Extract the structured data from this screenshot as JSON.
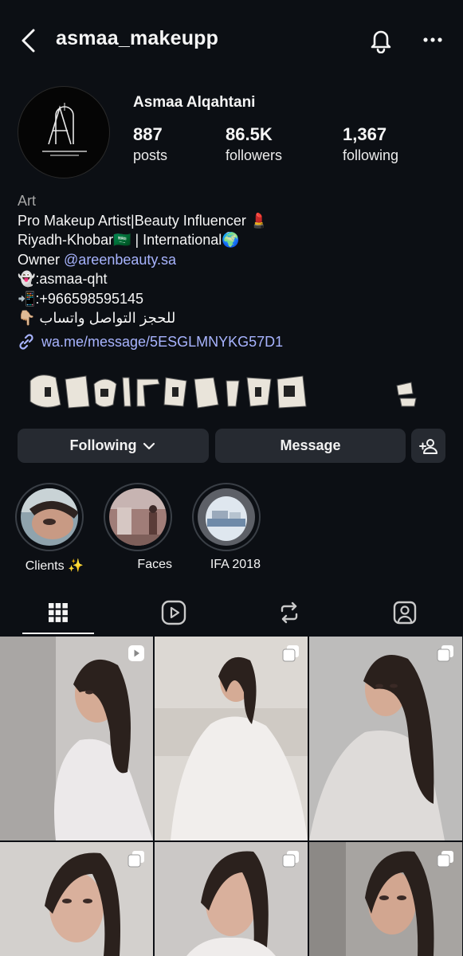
{
  "header": {
    "username": "asmaa_makeupp",
    "back_icon": "chevron-left-icon",
    "bell_icon": "bell-icon",
    "more_icon": "more-horizontal-icon"
  },
  "profile": {
    "full_name": "Asmaa Alqahtani",
    "avatar_logo_text": "Asmaa AlQahtani Makeup Artist",
    "stats": [
      {
        "value": "887",
        "label": "posts"
      },
      {
        "value": "86.5K",
        "label": "followers"
      },
      {
        "value": "1,367",
        "label": "following"
      }
    ]
  },
  "bio": {
    "category": "Art",
    "line1": "Pro Makeup Artist|Beauty Influencer 💄",
    "line2": "Riyadh-Khobar🇸🇦 | International🌍",
    "line3_prefix": "Owner ",
    "line3_mention": "@areenbeauty.sa",
    "line4": "👻:asmaa-qht",
    "line5": "📲:+966598595145",
    "line6": "👇🏼 للحجز التواصل واتساب",
    "link": "wa.me/message/5ESGLMNYKG57D1"
  },
  "actions": {
    "following_label": "Following",
    "message_label": "Message",
    "add_user_icon": "add-user-icon"
  },
  "highlights": [
    {
      "label": "Clients ✨"
    },
    {
      "label": "Faces"
    },
    {
      "label": "IFA 2018"
    }
  ],
  "tabs": [
    {
      "icon": "grid-icon",
      "active": true
    },
    {
      "icon": "reels-icon",
      "active": false
    },
    {
      "icon": "reposts-icon",
      "active": false
    },
    {
      "icon": "tagged-icon",
      "active": false
    }
  ],
  "colors": {
    "background": "#0c0f14",
    "button": "#262a31",
    "link": "#a8b4ff",
    "muted": "#a6a6a6"
  }
}
